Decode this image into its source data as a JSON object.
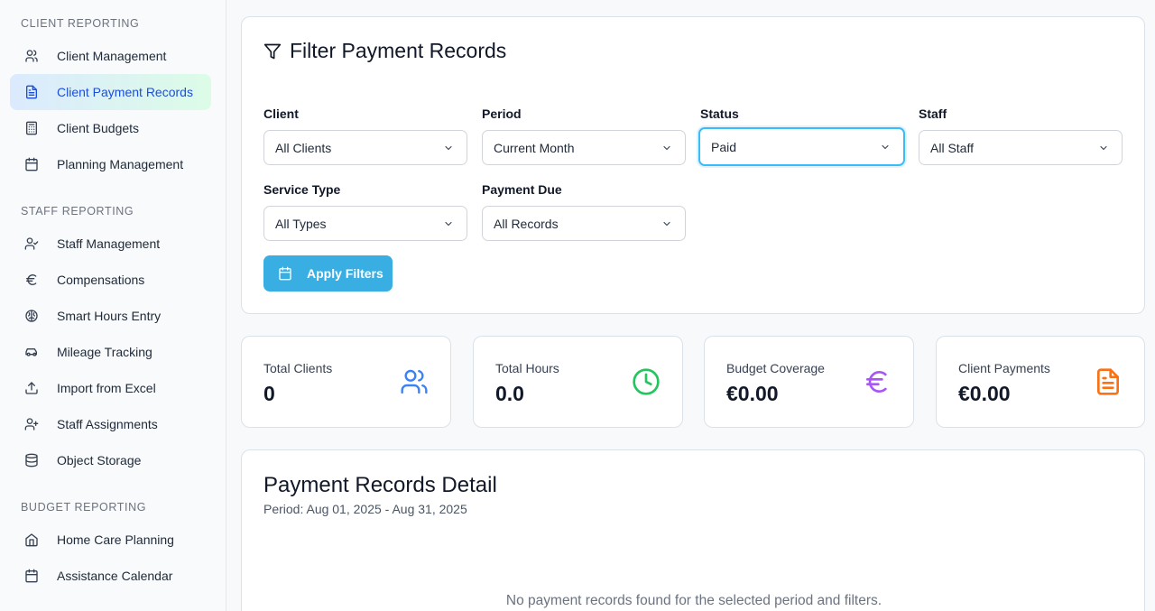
{
  "sidebar": {
    "sections": [
      {
        "label": "CLIENT REPORTING"
      },
      {
        "label": "STAFF REPORTING"
      },
      {
        "label": "BUDGET REPORTING"
      }
    ],
    "items": [
      {
        "label": "Client Management",
        "icon": "users-icon"
      },
      {
        "label": "Client Payment Records",
        "icon": "document-icon",
        "active": true
      },
      {
        "label": "Client Budgets",
        "icon": "calculator-icon"
      },
      {
        "label": "Planning Management",
        "icon": "calendar-icon"
      },
      {
        "label": "Staff Management",
        "icon": "user-check-icon"
      },
      {
        "label": "Compensations",
        "icon": "euro-icon"
      },
      {
        "label": "Smart Hours Entry",
        "icon": "brain-icon"
      },
      {
        "label": "Mileage Tracking",
        "icon": "car-icon"
      },
      {
        "label": "Import from Excel",
        "icon": "upload-icon"
      },
      {
        "label": "Staff Assignments",
        "icon": "user-plus-icon"
      },
      {
        "label": "Object Storage",
        "icon": "database-icon"
      },
      {
        "label": "Home Care Planning",
        "icon": "home-icon"
      },
      {
        "label": "Assistance Calendar",
        "icon": "calendar-icon"
      }
    ]
  },
  "filters": {
    "title": "Filter Payment Records",
    "fields": [
      {
        "label": "Client",
        "value": "All Clients"
      },
      {
        "label": "Period",
        "value": "Current Month"
      },
      {
        "label": "Status",
        "value": "Paid"
      },
      {
        "label": "Staff",
        "value": "All Staff"
      },
      {
        "label": "Service Type",
        "value": "All Types"
      },
      {
        "label": "Payment Due",
        "value": "All Records"
      }
    ],
    "apply_label": "Apply Filters"
  },
  "stats": [
    {
      "label": "Total Clients",
      "value": "0",
      "icon": "users-icon",
      "color": "#3b82f6"
    },
    {
      "label": "Total Hours",
      "value": "0.0",
      "icon": "clock-icon",
      "color": "#22c55e"
    },
    {
      "label": "Budget Coverage",
      "value": "€0.00",
      "icon": "euro-icon",
      "color": "#a855f7"
    },
    {
      "label": "Client Payments",
      "value": "€0.00",
      "icon": "document-icon",
      "color": "#f97316"
    }
  ],
  "detail": {
    "title": "Payment Records Detail",
    "period": "Period: Aug 01, 2025 - Aug 31, 2025",
    "empty_message": "No payment records found for the selected period and filters."
  }
}
